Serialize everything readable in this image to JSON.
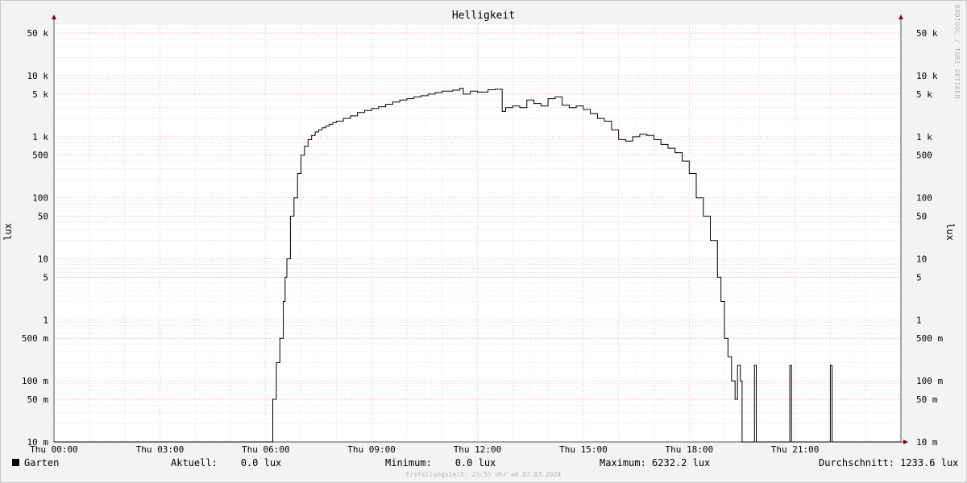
{
  "chart_data": {
    "type": "line",
    "title": "Helligkeit",
    "ylabel": "lux",
    "y_scale": "log",
    "ylim": [
      0.01,
      70000
    ],
    "xlim": [
      0,
      24
    ],
    "grid": true,
    "y_ticks": [
      {
        "v": 0.01,
        "label": "10 m"
      },
      {
        "v": 0.05,
        "label": "50 m"
      },
      {
        "v": 0.1,
        "label": "100 m"
      },
      {
        "v": 0.5,
        "label": "500 m"
      },
      {
        "v": 1,
        "label": "1"
      },
      {
        "v": 5,
        "label": "5"
      },
      {
        "v": 10,
        "label": "10"
      },
      {
        "v": 50,
        "label": "50"
      },
      {
        "v": 100,
        "label": "100"
      },
      {
        "v": 500,
        "label": "500"
      },
      {
        "v": 1000,
        "label": "1 k"
      },
      {
        "v": 5000,
        "label": "5 k"
      },
      {
        "v": 10000,
        "label": "10 k"
      },
      {
        "v": 50000,
        "label": "50 k"
      }
    ],
    "x_ticks": [
      {
        "v": 0,
        "label": "Thu 00:00"
      },
      {
        "v": 3,
        "label": "Thu 03:00"
      },
      {
        "v": 6,
        "label": "Thu 06:00"
      },
      {
        "v": 9,
        "label": "Thu 09:00"
      },
      {
        "v": 12,
        "label": "Thu 12:00"
      },
      {
        "v": 15,
        "label": "Thu 15:00"
      },
      {
        "v": 18,
        "label": "Thu 18:00"
      },
      {
        "v": 21,
        "label": "Thu 21:00"
      }
    ],
    "series": [
      {
        "name": "Garten",
        "color": "#000000",
        "x": [
          0,
          6.17,
          6.2,
          6.3,
          6.4,
          6.5,
          6.55,
          6.6,
          6.7,
          6.8,
          6.9,
          7.0,
          7.1,
          7.2,
          7.3,
          7.4,
          7.5,
          7.6,
          7.7,
          7.8,
          7.9,
          8.0,
          8.2,
          8.4,
          8.6,
          8.8,
          9.0,
          9.2,
          9.4,
          9.6,
          9.8,
          10.0,
          10.2,
          10.4,
          10.6,
          10.8,
          11.0,
          11.3,
          11.5,
          11.6,
          11.8,
          12.0,
          12.3,
          12.5,
          12.7,
          12.8,
          13.0,
          13.2,
          13.4,
          13.6,
          13.8,
          14.0,
          14.2,
          14.4,
          14.6,
          14.8,
          15.0,
          15.2,
          15.4,
          15.6,
          15.8,
          16.0,
          16.2,
          16.4,
          16.6,
          16.8,
          17.0,
          17.2,
          17.4,
          17.6,
          17.8,
          18.0,
          18.2,
          18.4,
          18.6,
          18.8,
          18.9,
          19.0,
          19.1,
          19.2,
          19.3,
          19.37,
          19.4,
          19.45,
          19.5,
          19.6,
          19.7,
          19.8,
          19.85,
          19.9,
          20.0,
          20.8,
          20.85,
          20.9,
          21.95,
          22.0,
          22.05,
          24
        ],
        "y": [
          0.01,
          0.01,
          0.05,
          0.2,
          0.5,
          2,
          5,
          10,
          50,
          100,
          250,
          500,
          700,
          900,
          1050,
          1200,
          1300,
          1400,
          1500,
          1600,
          1700,
          1800,
          2000,
          2200,
          2500,
          2700,
          2900,
          3100,
          3400,
          3700,
          4000,
          4200,
          4500,
          4700,
          5000,
          5300,
          5600,
          5800,
          6232,
          5000,
          5600,
          5400,
          5900,
          6000,
          2600,
          3000,
          3200,
          3000,
          4000,
          3500,
          3200,
          4200,
          4500,
          3300,
          3000,
          3200,
          2800,
          2400,
          2000,
          1800,
          1300,
          900,
          850,
          1000,
          1100,
          1050,
          900,
          750,
          650,
          550,
          400,
          250,
          100,
          50,
          20,
          5,
          2,
          0.5,
          0.25,
          0.1,
          0.05,
          0.18,
          0.18,
          0.1,
          0.01,
          0.01,
          0.01,
          0.01,
          0.18,
          0.01,
          0.01,
          0.01,
          0.18,
          0.01,
          0.01,
          0.18,
          0.01,
          0.01
        ]
      }
    ]
  },
  "legend": {
    "series_label": "Garten",
    "aktuell": "Aktuell:    0.0 lux",
    "minimum": "Minimum:    0.0 lux",
    "maximum": "Maximum: 6232.2 lux",
    "durchschnitt": "Durchschnitt: 1233.6 lux"
  },
  "footer": "Erstellungszeit: 23:55 Uhr am 07.03.2024",
  "watermark": "RRDTOOL / TOBI OETIKER",
  "colors": {
    "background": "#f3f3f3",
    "canvas": "#ffffff",
    "major_grid": "#ff9a9a",
    "minor_grid": "#d8d8d8",
    "axis": "#8b0000"
  }
}
